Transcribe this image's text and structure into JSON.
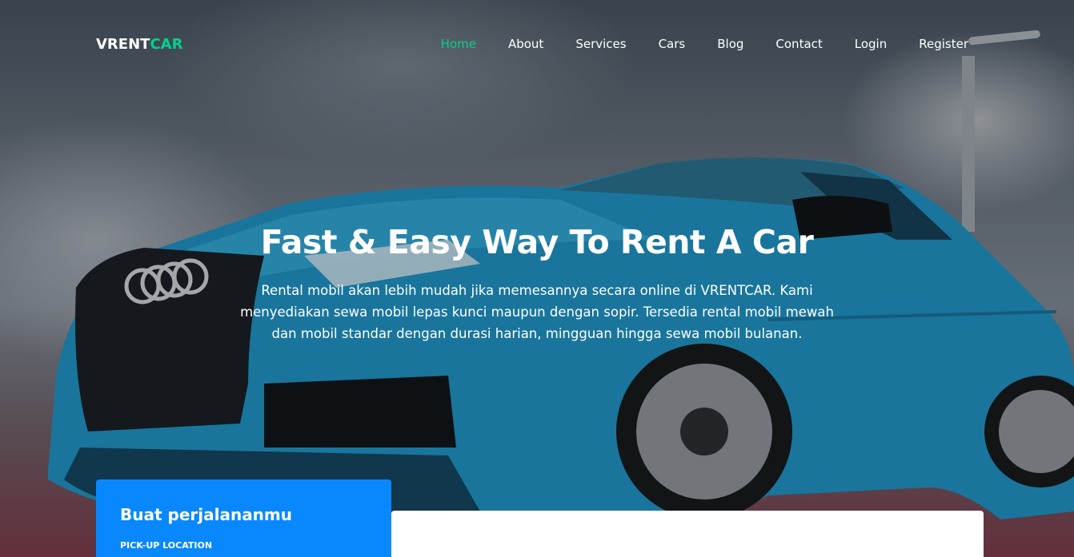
{
  "brand": {
    "logo_part1": "VRENT",
    "logo_part2": "CAR"
  },
  "nav": {
    "items": [
      {
        "label": "Home",
        "active": true
      },
      {
        "label": "About"
      },
      {
        "label": "Services"
      },
      {
        "label": "Cars"
      },
      {
        "label": "Blog"
      },
      {
        "label": "Contact"
      },
      {
        "label": "Login"
      },
      {
        "label": "Register"
      }
    ]
  },
  "hero": {
    "title": "Fast & Easy Way To Rent A Car",
    "description": "Rental mobil akan lebih mudah jika memesannya secara online di VRENTCAR. Kami menyediakan sewa mobil lepas kunci maupun dengan sopir. Tersedia rental mobil mewah dan mobil standar dengan durasi harian, mingguan hingga sewa mobil bulanan."
  },
  "booking": {
    "title": "Buat perjalananmu",
    "pickup_label": "PICK-UP LOCATION"
  },
  "colors": {
    "accent": "#01d28e",
    "booking_card": "#0988fe",
    "car_body": "#1e8fc0"
  }
}
